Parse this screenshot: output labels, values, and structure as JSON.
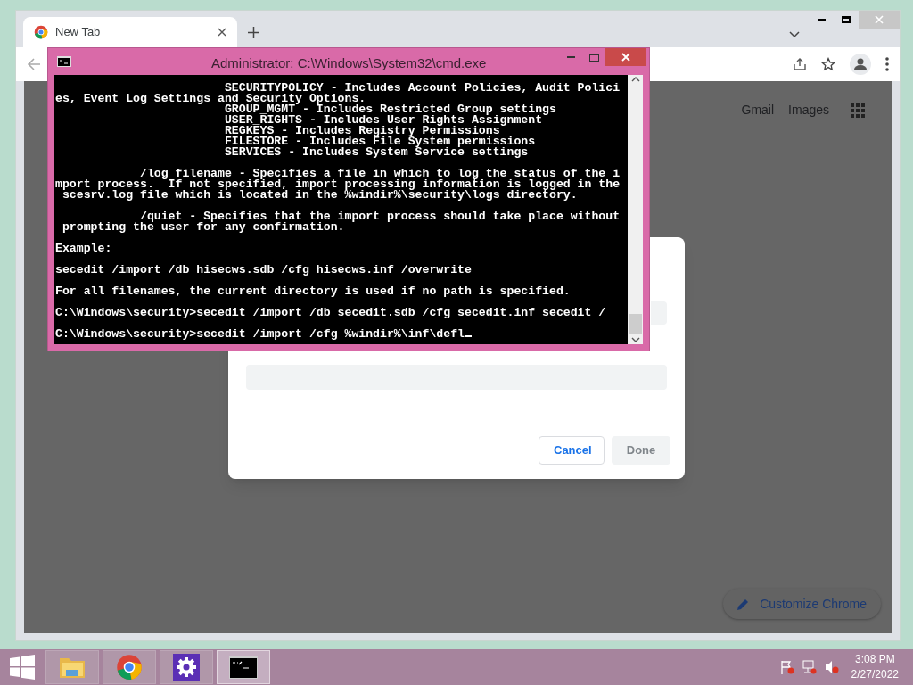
{
  "browser": {
    "tabs": [
      {
        "title": "New Tab",
        "selected": true
      }
    ],
    "header_links": [
      "Gmail",
      "Images"
    ],
    "customize_button": "Customize Chrome",
    "dialog": {
      "buttons": [
        {
          "label": "Cancel",
          "disabled": false
        },
        {
          "label": "Done",
          "disabled": true
        }
      ]
    }
  },
  "console": {
    "title": "Administrator: C:\\Windows\\System32\\cmd.exe",
    "blocks": [
      [
        "                        SECURITYPOLICY - Includes Account Policies, Audit Polici",
        "es, Event Log Settings and Security Options.",
        "                        GROUP_MGMT - Includes Restricted Group settings",
        "                        USER_RIGHTS - Includes User Rights Assignment",
        "                        REGKEYS - Includes Registry Permissions",
        "                        FILESTORE - Includes File System permissions",
        "                        SERVICES - Includes System Service settings"
      ],
      [
        "            /log filename - Specifies a file in which to log the status of the i",
        "mport process.  If not specified, import processing information is logged in the",
        " scesrv.log file which is located in the %windir%\\security\\logs directory."
      ],
      [
        "            /quiet - Specifies that the import process should take place without",
        " prompting the user for any confirmation."
      ],
      [
        "Example:"
      ],
      [
        "secedit /import /db hisecws.sdb /cfg hisecws.inf /overwrite"
      ],
      [
        "For all filenames, the current directory is used if no path is specified."
      ],
      [
        "C:\\Windows\\security>secedit /import /db secedit.sdb /cfg secedit.inf secedit /"
      ],
      [
        "C:\\Windows\\security>secedit /import /cfg %windir%\\inf\\defl"
      ]
    ]
  },
  "taskbar": {
    "apps": [
      {
        "kind": "explorer",
        "selected": false
      },
      {
        "kind": "chrome",
        "selected": false
      },
      {
        "kind": "settings",
        "selected": false
      },
      {
        "kind": "console",
        "selected": true
      }
    ],
    "time": "3:08 PM",
    "date": "2/27/2022"
  }
}
